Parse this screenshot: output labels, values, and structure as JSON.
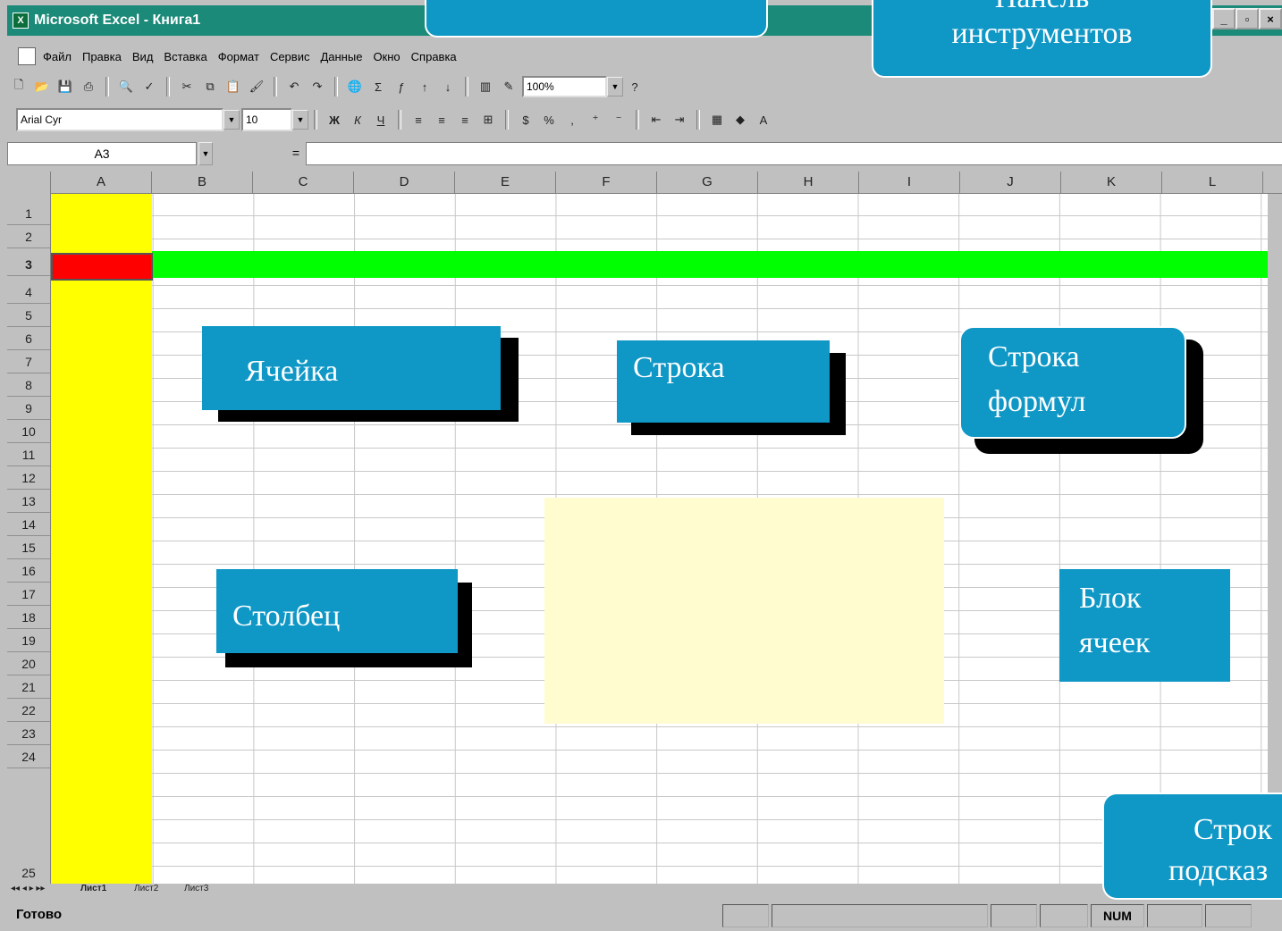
{
  "window": {
    "title": "Microsoft Excel - Книга1"
  },
  "menu": [
    "Файл",
    "Правка",
    "Вид",
    "Вставка",
    "Формат",
    "Сервис",
    "Данные",
    "Окно",
    "Справка"
  ],
  "toolbar": {
    "zoom": "100%",
    "font": "Arial Cyr",
    "size": "10",
    "bold": "Ж",
    "italic": "К",
    "underline": "Ч"
  },
  "formula_bar": {
    "name_box": "A3",
    "eq": "="
  },
  "columns": [
    "A",
    "B",
    "C",
    "D",
    "E",
    "F",
    "G",
    "H",
    "I",
    "J",
    "K",
    "L"
  ],
  "rows": [
    "1",
    "2",
    "3",
    "4",
    "5",
    "6",
    "7",
    "8",
    "9",
    "10",
    "11",
    "12",
    "13",
    "14",
    "15",
    "16",
    "17",
    "18",
    "19",
    "20",
    "21",
    "22",
    "23",
    "24",
    "25"
  ],
  "sheet_tabs": [
    "Лист1",
    "Лист2",
    "Лист3"
  ],
  "status": {
    "ready": "Готово",
    "num": "NUM"
  },
  "callouts": {
    "toolbar_panel_line1": "Панель",
    "toolbar_panel_line2": "инструментов",
    "cell": "Ячейка",
    "row": "Строка",
    "formula_line1": "Строка",
    "formula_line2": "формул",
    "column": "Столбец",
    "block_line1": "Блок",
    "block_line2": "ячеек",
    "hint_line1": "Строк",
    "hint_line2": "подсказ"
  }
}
